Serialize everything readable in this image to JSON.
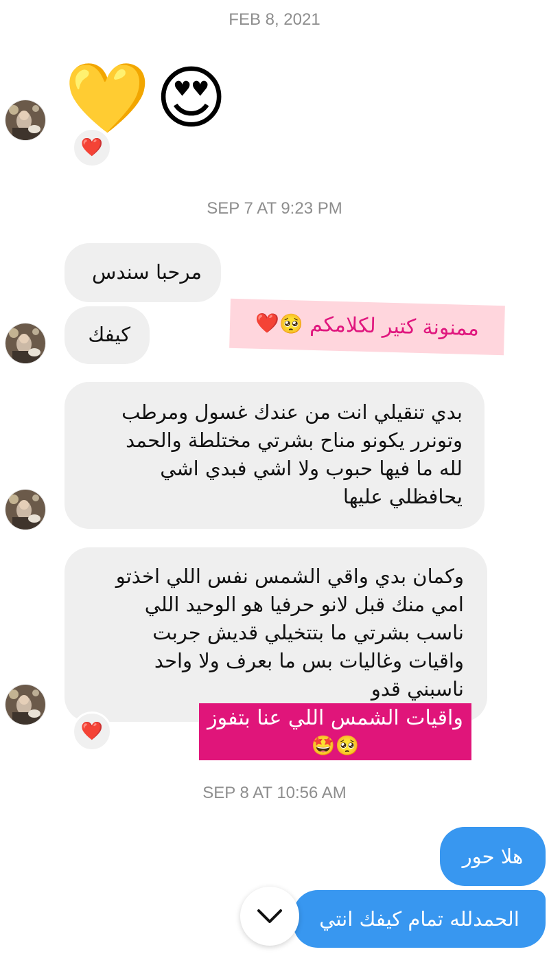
{
  "timestamps": {
    "t1": "FEB 8, 2021",
    "t2": "SEP 7 AT 9:23 PM",
    "t3": "SEP 8 AT 10:56 AM"
  },
  "emoji_message": {
    "yellow_heart": "💛",
    "heart_eyes": "😍"
  },
  "reaction_icon": "❤️",
  "incoming": {
    "msg1": "مرحبا سندس",
    "msg2": "كيفك",
    "msg3": [
      "بدي تنقيلي انت من عندك  غسول ومرطب",
      "وتونرر  يكونو مناح بشرتي مختلطة والحمد",
      "لله ما فيها حبوب ولا اشي  فبدي اشي",
      "يحافظلي عليها"
    ],
    "msg4": [
      "وكمان بدي  واقي الشمس نفس اللي اخذتو",
      "امي منك قبل لانو حرفيا هو الوحيد اللي",
      "ناسب بشرتي   ما بتتخيلي قديش جربت",
      "واقيات وغاليات  بس ما بعرف ولا واحد",
      "ناسبني قدو"
    ]
  },
  "stickers": {
    "pink": "ممنونة كتير لكلامكم",
    "pink_emoji": "🥺❤️",
    "magenta": "واقيات الشمس اللي عنا بتفوز",
    "magenta_emoji": "🥺🤩"
  },
  "outgoing": {
    "msg1": "هلا حور",
    "msg2": "الحمدلله تمام كيفك انتي"
  },
  "icons": {
    "avatar": "avatar-photo",
    "scroll_down": "chevron-down-icon"
  },
  "colors": {
    "incoming_bubble": "#efefef",
    "outgoing_bubble": "#3897f0",
    "pink_sticker_bg": "#ffd6dd",
    "pink_sticker_text": "#e0177e",
    "magenta_sticker_bg": "#e0157a",
    "timestamp": "#8e8e8e"
  }
}
